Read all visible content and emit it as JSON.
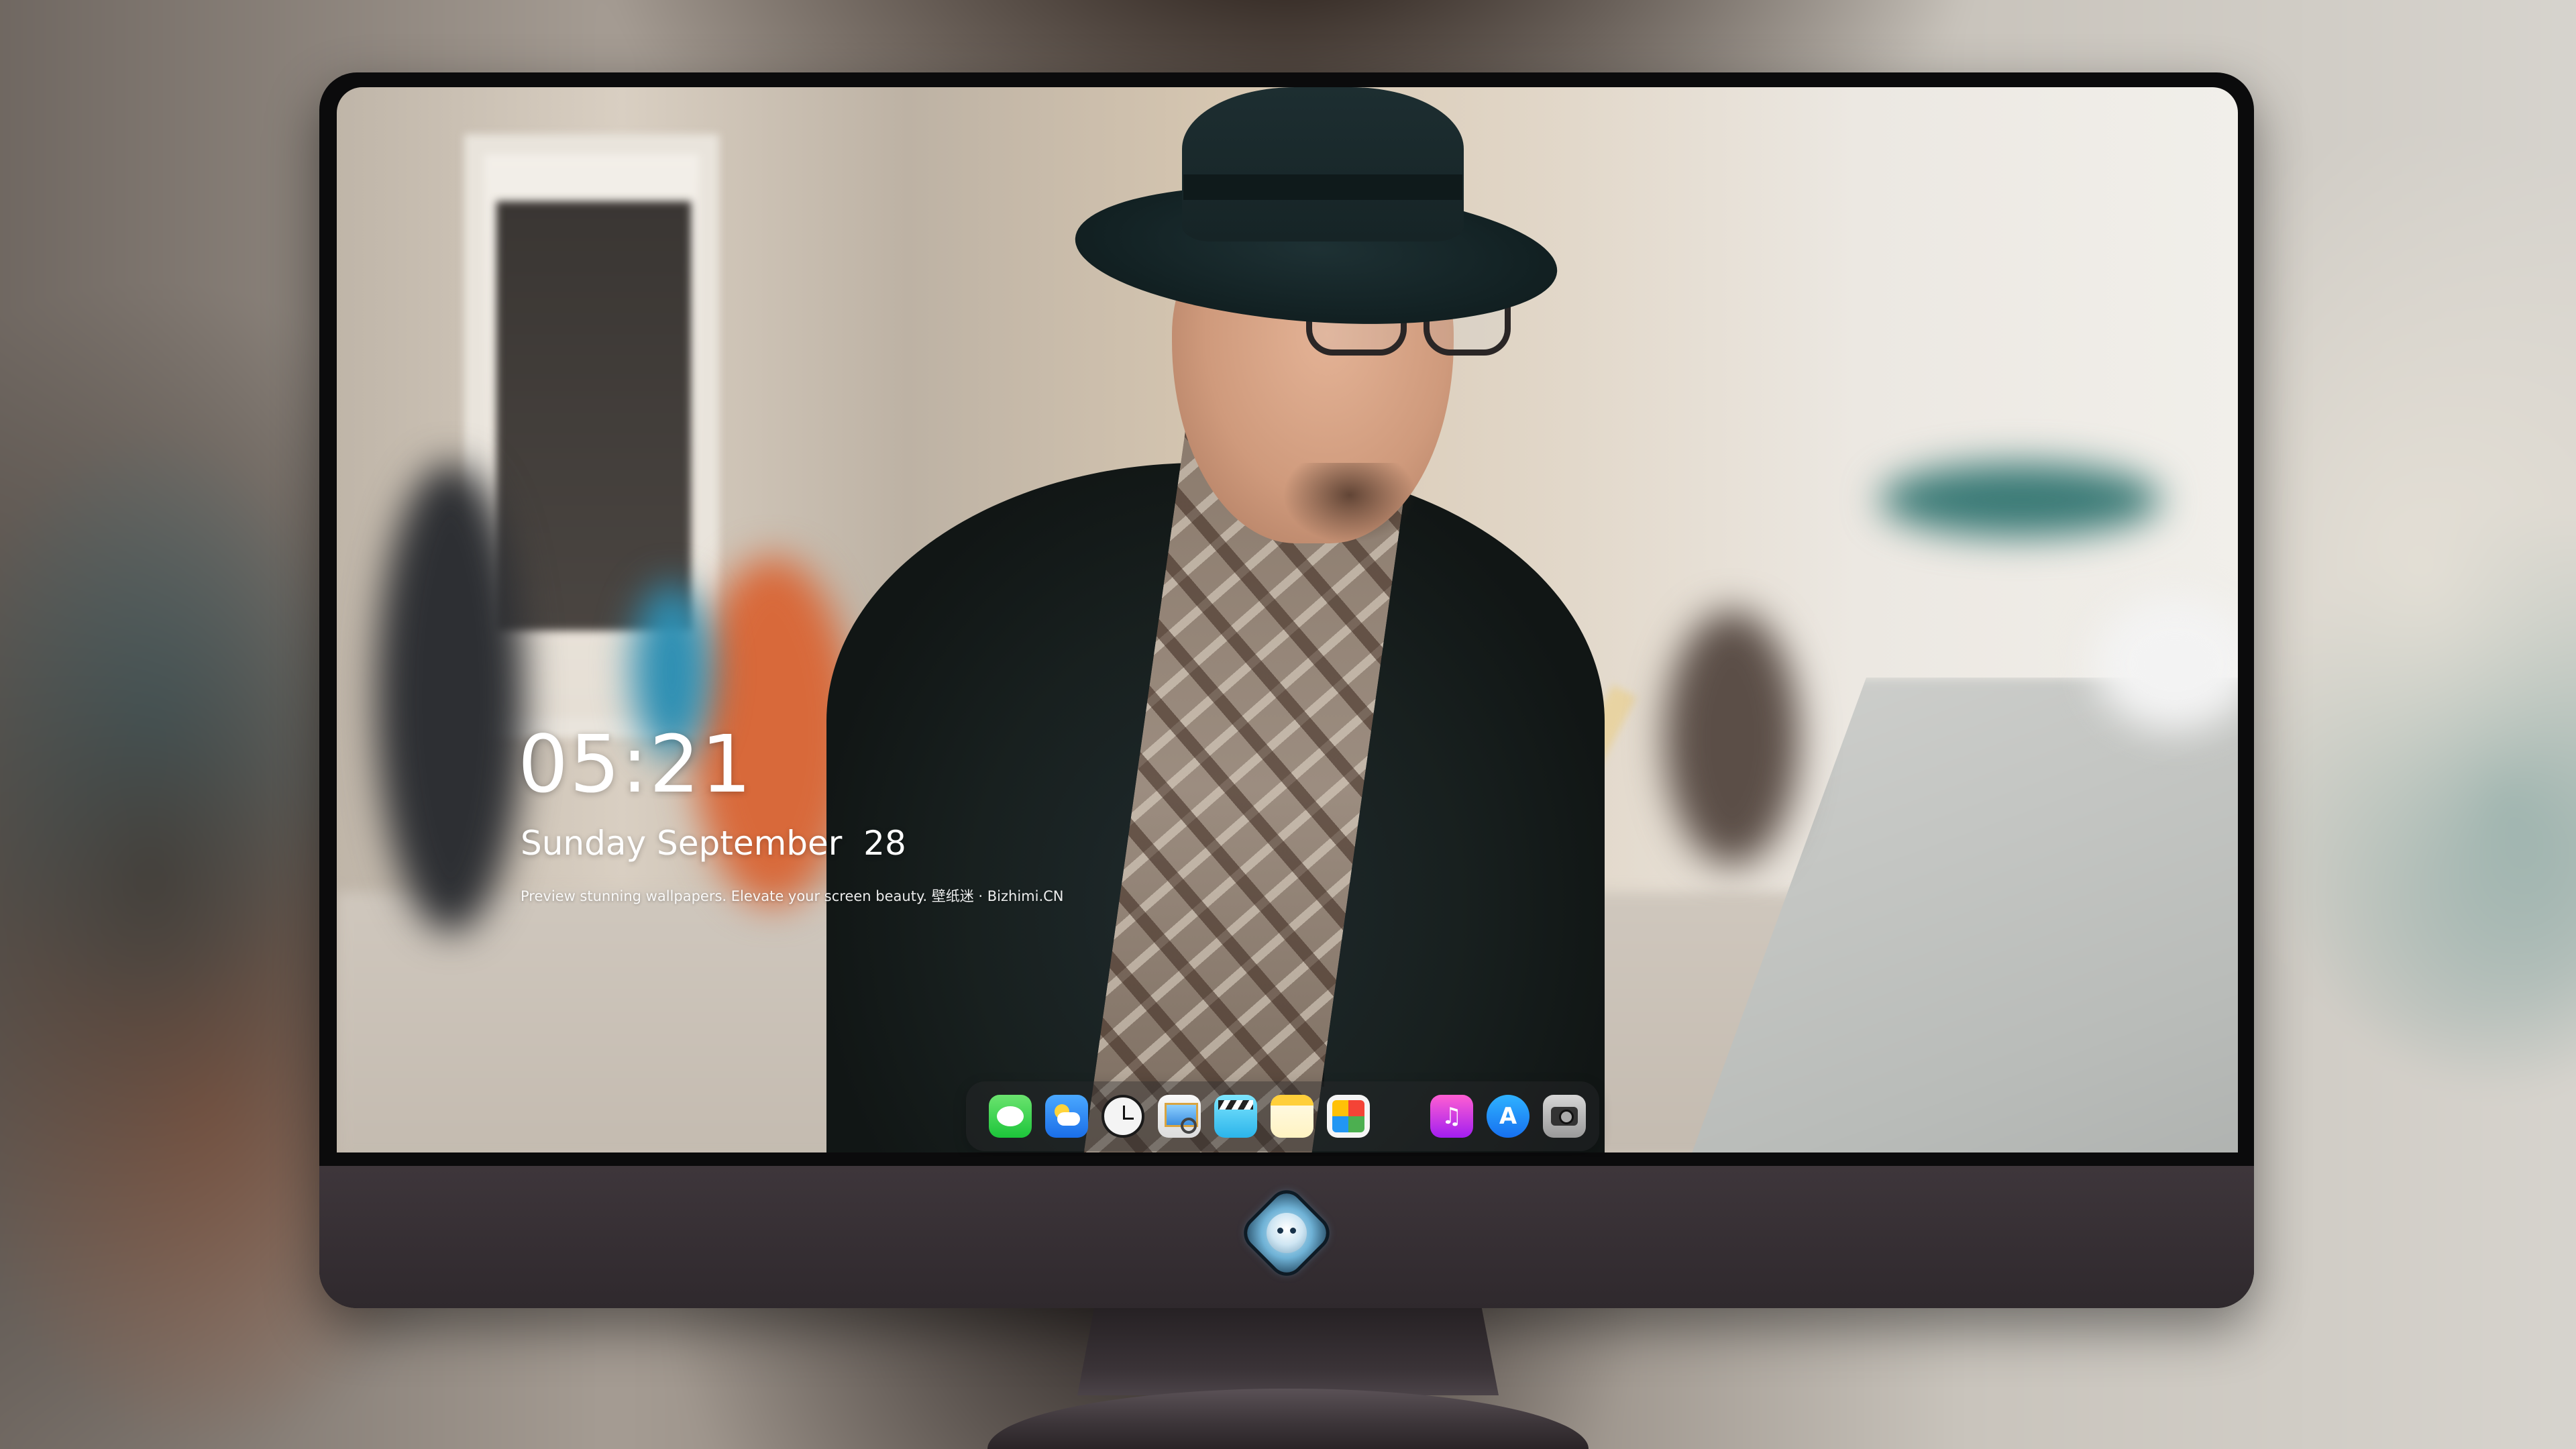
{
  "lockscreen": {
    "time": "05:21",
    "date": "Sunday September  28",
    "caption": "Preview stunning wallpapers. Elevate your screen beauty. 壁纸迷 · Bizhimi.CN"
  },
  "dock": {
    "apps": [
      {
        "name": "messages",
        "icon": "messages-icon"
      },
      {
        "name": "weather",
        "icon": "weather-icon"
      },
      {
        "name": "clock",
        "icon": "clock-icon"
      },
      {
        "name": "preview",
        "icon": "preview-icon"
      },
      {
        "name": "video",
        "icon": "clapperboard-icon"
      },
      {
        "name": "notes",
        "icon": "notes-icon"
      },
      {
        "name": "photos",
        "icon": "photos-icon"
      },
      {
        "name": "music",
        "icon": "music-note-icon",
        "glyph": "♫"
      },
      {
        "name": "app-store",
        "icon": "app-store-icon",
        "glyph": "A"
      },
      {
        "name": "camera",
        "icon": "camera-icon"
      }
    ]
  },
  "colors": {
    "monitor_chin": "#3e363b",
    "monitor_bezel": "#0b0b0c",
    "clock_text": "#ffffff"
  }
}
